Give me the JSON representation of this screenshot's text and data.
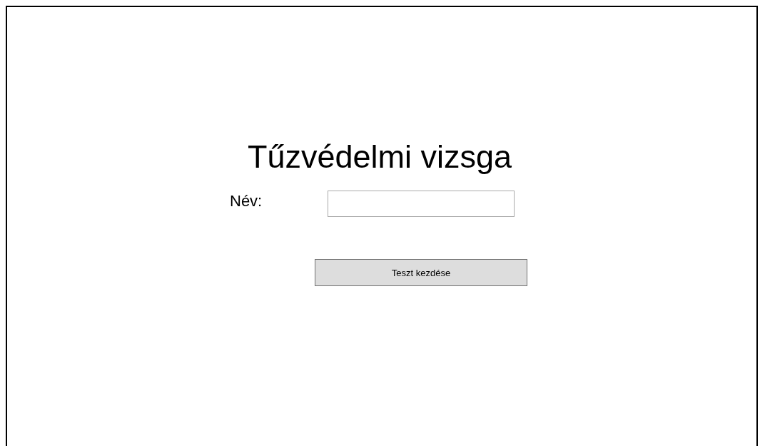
{
  "title": "Tűzvédelmi vizsga",
  "name_field": {
    "label": "Név:"
  },
  "start_button": {
    "label": "Teszt kezdése"
  }
}
